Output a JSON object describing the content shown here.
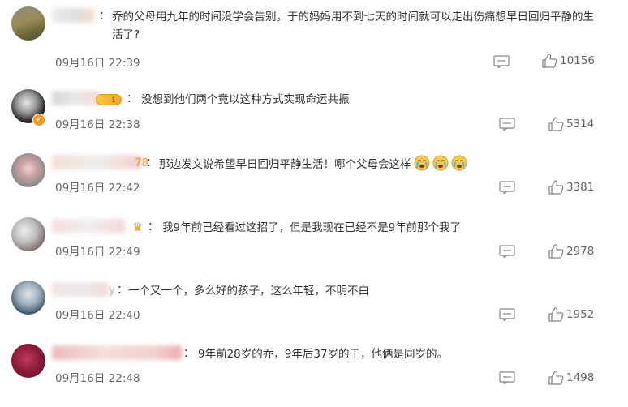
{
  "comments": [
    {
      "username": "",
      "content": "乔的父母用九年的时间没学会告别，于的妈妈用不到七天的时间就可以走出伤痛想早日回归平静的生活了?",
      "time": "09月16日 22:39",
      "likes": "10156"
    },
    {
      "username": "",
      "level": "1",
      "content": "没想到他们两个竟以这种方式实现命运共振",
      "time": "09月16日 22:38",
      "likes": "5314"
    },
    {
      "username": "",
      "username_tail": "78",
      "content": "那边发文说希望早日回归平静生活！哪个父母会这样",
      "time": "09月16日 22:42",
      "likes": "3381"
    },
    {
      "username": "",
      "content": "我9年前已经看过这招了，但是我现在已经不是9年前那个我了",
      "time": "09月16日 22:49",
      "likes": "2978"
    },
    {
      "username": "",
      "username_tail": "y",
      "content": "一个又一个，多么好的孩子，这么年轻，不明不白",
      "time": "09月16日 22:40",
      "likes": "1952"
    },
    {
      "username": "",
      "content": "9年前28岁的乔，9年后37岁的于，他俩是同岁的。",
      "time": "09月16日 22:48",
      "likes": "1498"
    }
  ],
  "colors": {
    "text": "#333333",
    "meta": "#666666",
    "icon": "#888888",
    "level_badge": "#f3a526",
    "verified_badge": "#f29a25"
  },
  "icons": {
    "reply": "reply-icon",
    "like": "thumbs-up-icon",
    "crying_emoji": "crying-face-icon",
    "crown": "crown-icon"
  }
}
